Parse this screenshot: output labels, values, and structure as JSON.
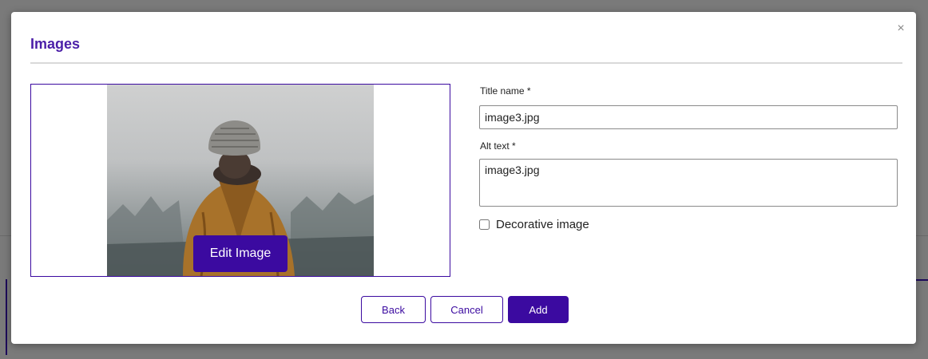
{
  "modal": {
    "title": "Images",
    "close_glyph": "×",
    "close_icon": "close-icon"
  },
  "image_panel": {
    "edit_button_label": "Edit Image",
    "image_alt": "image3.jpg"
  },
  "form": {
    "title_label": "Title name *",
    "title_value": "image3.jpg",
    "alt_label": "Alt text *",
    "alt_value": "image3.jpg",
    "decorative_label": "Decorative image",
    "decorative_checked": false
  },
  "footer": {
    "back_label": "Back",
    "cancel_label": "Cancel",
    "add_label": "Add"
  },
  "colors": {
    "accent": "#3b0aa0",
    "title": "#4b1fa8",
    "overlay": "#7a7a7a"
  }
}
